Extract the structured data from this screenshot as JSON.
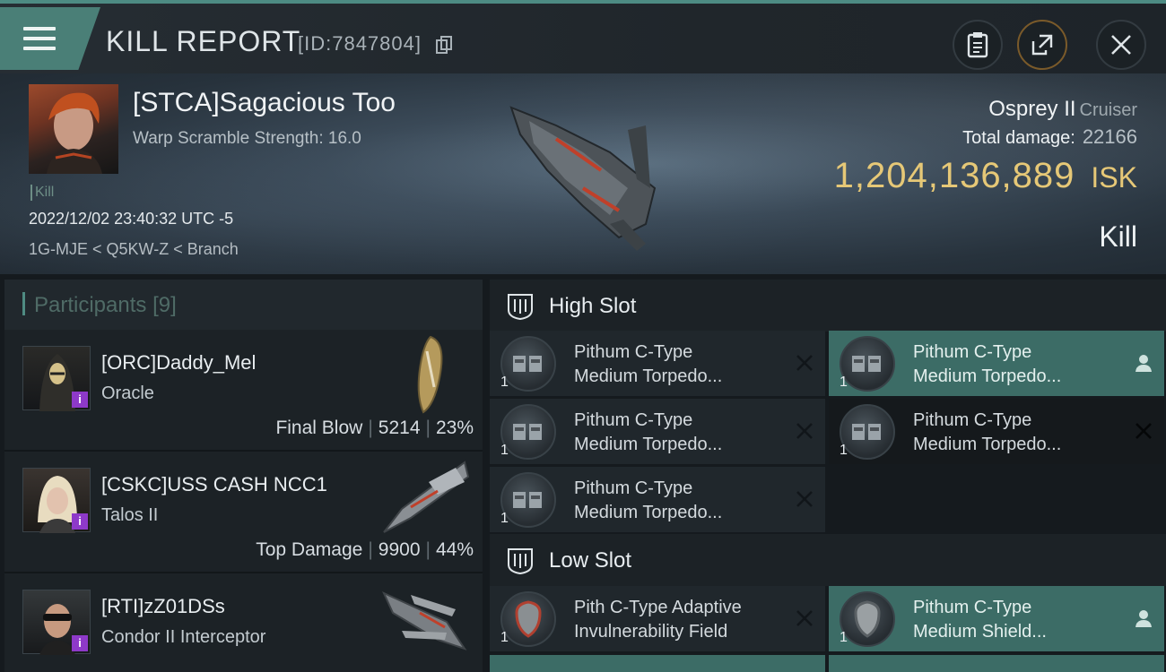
{
  "header": {
    "title": "KILL REPORT",
    "report_id": "[ID:7847804]"
  },
  "victim": {
    "pilot": "[STCA]Sagacious Too",
    "scramble_label": "Warp Scramble Strength: 16.0",
    "tag": "Kill",
    "timestamp": "2022/12/02 23:40:32 UTC -5",
    "location": "1G-MJE < Q5KW-Z < Branch",
    "ship_name": "Osprey II",
    "ship_class": "Cruiser",
    "damage_label": "Total damage:",
    "damage_value": "22166",
    "isk_value": "1,204,136,889",
    "isk_unit": "ISK",
    "result": "Kill"
  },
  "participants": {
    "heading": "Participants",
    "count": "[9]",
    "items": [
      {
        "name": "[ORC]Daddy_Mel",
        "ship": "Oracle",
        "role": "Final Blow",
        "damage": "5214",
        "percent": "23%",
        "badge": "i"
      },
      {
        "name": "[CSKC]USS CASH NCC1",
        "ship": "Talos II",
        "role": "Top Damage",
        "damage": "9900",
        "percent": "44%",
        "badge": "i"
      },
      {
        "name": "[RTI]zZ01DSs",
        "ship": "Condor II Interceptor",
        "badge": "i"
      }
    ]
  },
  "high_slot": {
    "label": "High Slot",
    "modules": [
      {
        "line1": "Pithum C-Type",
        "line2": "Medium Torpedo...",
        "qty": "1",
        "state": "destroyed"
      },
      {
        "line1": "Pithum C-Type",
        "line2": "Medium Torpedo...",
        "qty": "1",
        "state": "dropped"
      },
      {
        "line1": "Pithum C-Type",
        "line2": "Medium Torpedo...",
        "qty": "1",
        "state": "destroyed"
      },
      {
        "line1": "Pithum C-Type",
        "line2": "Medium Torpedo...",
        "qty": "1",
        "state": "destroyed"
      },
      {
        "line1": "Pithum C-Type",
        "line2": "Medium Torpedo...",
        "qty": "1",
        "state": "destroyed"
      }
    ]
  },
  "low_slot": {
    "label": "Low Slot",
    "modules": [
      {
        "line1": "Pith C-Type Adaptive",
        "line2": "Invulnerability Field",
        "qty": "1",
        "state": "destroyed"
      },
      {
        "line1": "Pithum C-Type",
        "line2": "Medium Shield...",
        "qty": "1",
        "state": "dropped"
      }
    ]
  },
  "icons": {
    "menu": "hamburger-icon",
    "copy": "copy-icon",
    "clipboard": "clipboard-icon",
    "share": "share-icon",
    "close": "close-icon",
    "destroyed": "x-icon",
    "dropped": "person-icon"
  },
  "colors": {
    "accent_teal": "#4a7f77",
    "isk_gold": "#e6c877",
    "corp_badge": "#8e39c9"
  }
}
